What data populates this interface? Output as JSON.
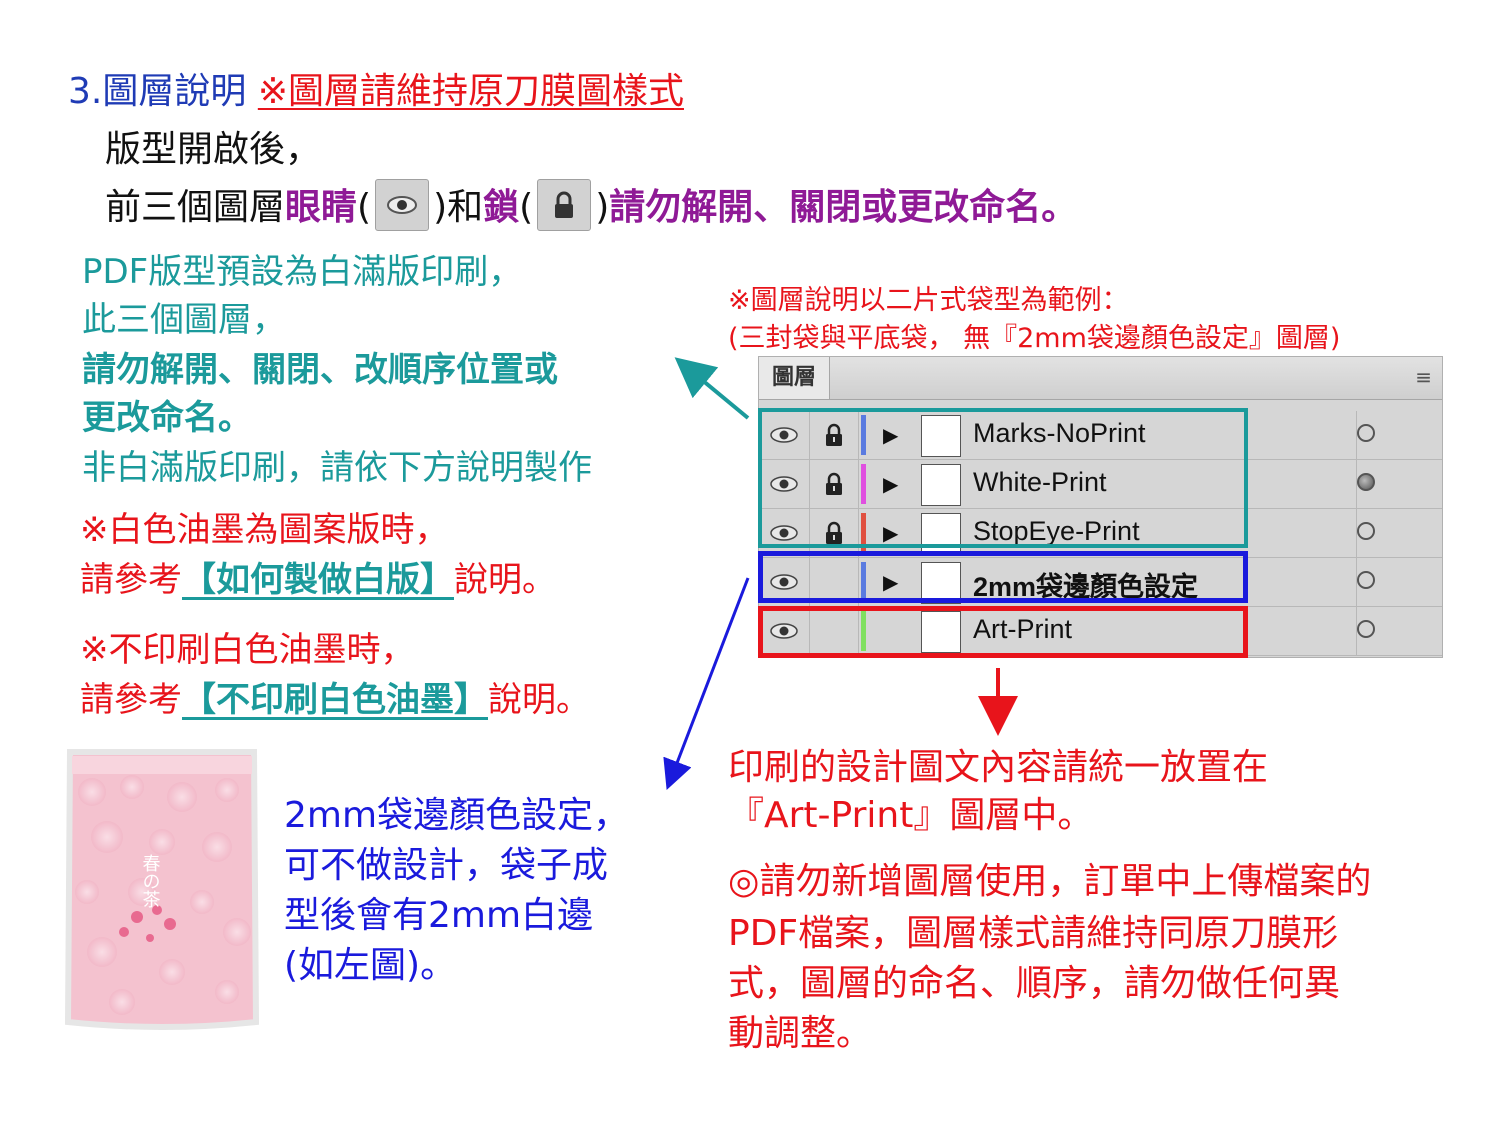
{
  "heading": {
    "num_title": "3.圖層說明",
    "warn": "※圖層請維持原刀膜圖樣式"
  },
  "line2": "版型開啟後，",
  "line3": {
    "pre": "前三個圖層",
    "eye_word": "眼睛",
    "open_paren": "(",
    "close_and": ")和",
    "lock_word": "鎖",
    "open_paren2": "(",
    "close_end": ")",
    "tail": "請勿解開、關閉或更改命名。"
  },
  "teal_block": {
    "l1": "PDF版型預設為白滿版印刷，",
    "l2": "此三個圖層，",
    "l3": "請勿解開、關閉、改順序位置或",
    "l4": "更改命名。",
    "l5": "非白滿版印刷，請依下方說明製作"
  },
  "red_block": {
    "l1": "※白色油墨為圖案版時，",
    "l2_pre": "請參考",
    "l2_link": "【如何製做白版】",
    "l2_post": "說明。",
    "l3": "※不印刷白色油墨時，",
    "l4_pre": "請參考",
    "l4_link": "【不印刷白色油墨】",
    "l4_post": "說明。"
  },
  "caption": {
    "l1": "※圖層說明以二片式袋型為範例：",
    "l2": "(三封袋與平底袋， 無『2mm袋邊顏色設定』圖層)"
  },
  "layers_panel": {
    "tab": "圖層",
    "menu_icon": "≡",
    "layers": [
      {
        "name": "Marks-NoPrint",
        "color": "#5a7be0",
        "locked": true,
        "target_filled": false
      },
      {
        "name": "White-Print",
        "color": "#e050e0",
        "locked": true,
        "target_filled": true
      },
      {
        "name": "StopEye-Print",
        "color": "#e05040",
        "locked": true,
        "target_filled": false
      },
      {
        "name": "2mm袋邊顏色設定",
        "color": "#5a7be0",
        "locked": false,
        "target_filled": false
      },
      {
        "name": "Art-Print",
        "color": "#80e060",
        "locked": false,
        "target_filled": false
      }
    ]
  },
  "bottom_red": {
    "l1": "印刷的設計圖文內容請統一放置在",
    "l2": "『Art-Print』圖層中。",
    "l3": "◎請勿新增圖層使用，訂單中上傳檔案的",
    "l4": "PDF檔案，圖層樣式請維持同原刀膜形",
    "l5": "式，圖層的命名、順序，請勿做任何異",
    "l6": "動調整。"
  },
  "blue_block": {
    "l1": "2mm袋邊顏色設定，",
    "l2": "可不做設計，袋子成",
    "l3": "型後會有2mm白邊",
    "l4": "(如左圖)。"
  },
  "bag_image": {
    "label": "春の茶"
  },
  "colors": {
    "teal": "#1b9a9b",
    "red": "#e8141b",
    "blue": "#1a1adc",
    "purple": "#8f1a96",
    "heading_blue": "#1f3bb5"
  }
}
